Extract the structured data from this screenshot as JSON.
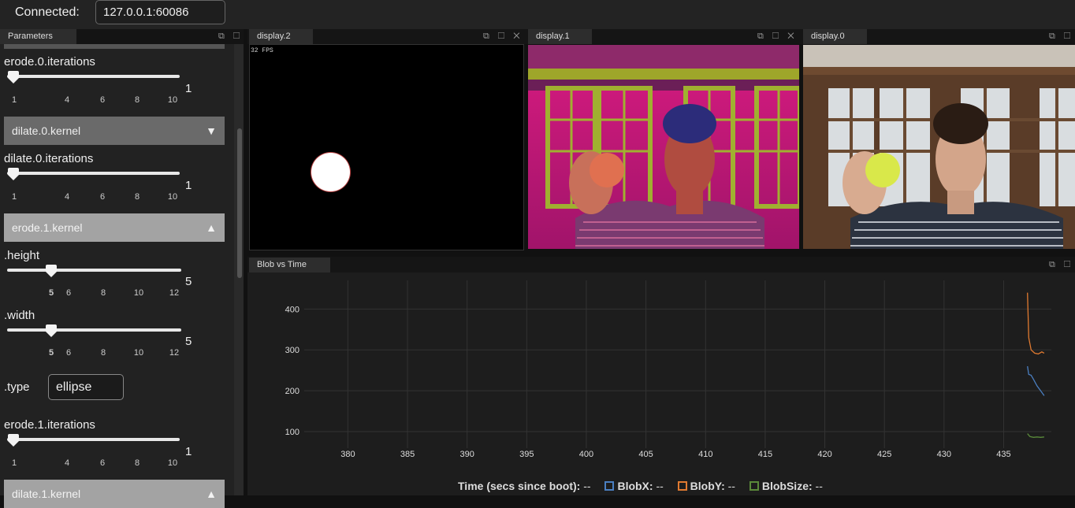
{
  "connection": {
    "label": "Connected:",
    "address": "127.0.0.1:60086"
  },
  "parameters_panel": {
    "tab": "Parameters",
    "erode0_iterations": {
      "label": "erode.0.iterations",
      "value": "1",
      "ticks": [
        "1",
        "4",
        "6",
        "8",
        "10"
      ]
    },
    "dilate0_kernel": {
      "label": "dilate.0.kernel",
      "arrow": "▼"
    },
    "dilate0_iterations": {
      "label": "dilate.0.iterations",
      "value": "1",
      "ticks": [
        "1",
        "4",
        "6",
        "8",
        "10"
      ]
    },
    "erode1_kernel": {
      "label": "erode.1.kernel",
      "arrow": "▲"
    },
    "height": {
      "label": ".height",
      "value": "5",
      "ticks": [
        "5",
        "6",
        "8",
        "10",
        "12"
      ]
    },
    "width": {
      "label": ".width",
      "value": "5",
      "ticks": [
        "5",
        "6",
        "8",
        "10",
        "12"
      ]
    },
    "type": {
      "label": ".type",
      "value": "ellipse"
    },
    "erode1_iterations": {
      "label": "erode.1.iterations",
      "value": "1",
      "ticks": [
        "1",
        "4",
        "6",
        "8",
        "10"
      ]
    },
    "dilate1_kernel": {
      "label": "dilate.1.kernel",
      "arrow": "▲"
    }
  },
  "displays": {
    "display2": {
      "tab": "display.2",
      "fps": "32 FPS"
    },
    "display1": {
      "tab": "display.1"
    },
    "display0": {
      "tab": "display.0"
    }
  },
  "window_icons": {
    "restore_maximize_close": "⧉ ☐ ✕",
    "restore_maximize": "⧉ ☐"
  },
  "chart_panel": {
    "tab": "Blob vs Time"
  },
  "legend": {
    "time": "Time (secs since boot):",
    "time_val": "--",
    "blobx": "BlobX:",
    "blobx_val": "--",
    "bloby": "BlobY:",
    "bloby_val": "--",
    "blobsize": "BlobSize:",
    "blobsize_val": "--"
  },
  "colors": {
    "blobx": "#4a7fc1",
    "bloby": "#e07a30",
    "blobsize": "#5a8a3a"
  },
  "chart_data": {
    "type": "line",
    "xlabel": "",
    "ylabel": "",
    "xlim": [
      377,
      439
    ],
    "ylim": [
      75,
      470
    ],
    "x_ticks": [
      380,
      385,
      390,
      395,
      400,
      405,
      410,
      415,
      420,
      425,
      430,
      435
    ],
    "y_ticks": [
      100,
      200,
      300,
      400
    ],
    "grid": true,
    "legend_placement": "bottom",
    "series": [
      {
        "name": "BlobX",
        "x": [
          437.0,
          437.1,
          437.3,
          437.5,
          437.8,
          438.1,
          438.4
        ],
        "y": [
          260,
          240,
          238,
          228,
          212,
          200,
          188
        ]
      },
      {
        "name": "BlobY",
        "x": [
          437.0,
          437.1,
          437.3,
          437.6,
          437.9,
          438.2,
          438.4
        ],
        "y": [
          440,
          330,
          300,
          292,
          290,
          295,
          292
        ]
      },
      {
        "name": "BlobSize",
        "x": [
          437.0,
          437.2,
          437.5,
          437.8,
          438.1,
          438.4
        ],
        "y": [
          95,
          88,
          86,
          87,
          86,
          87
        ]
      }
    ]
  }
}
